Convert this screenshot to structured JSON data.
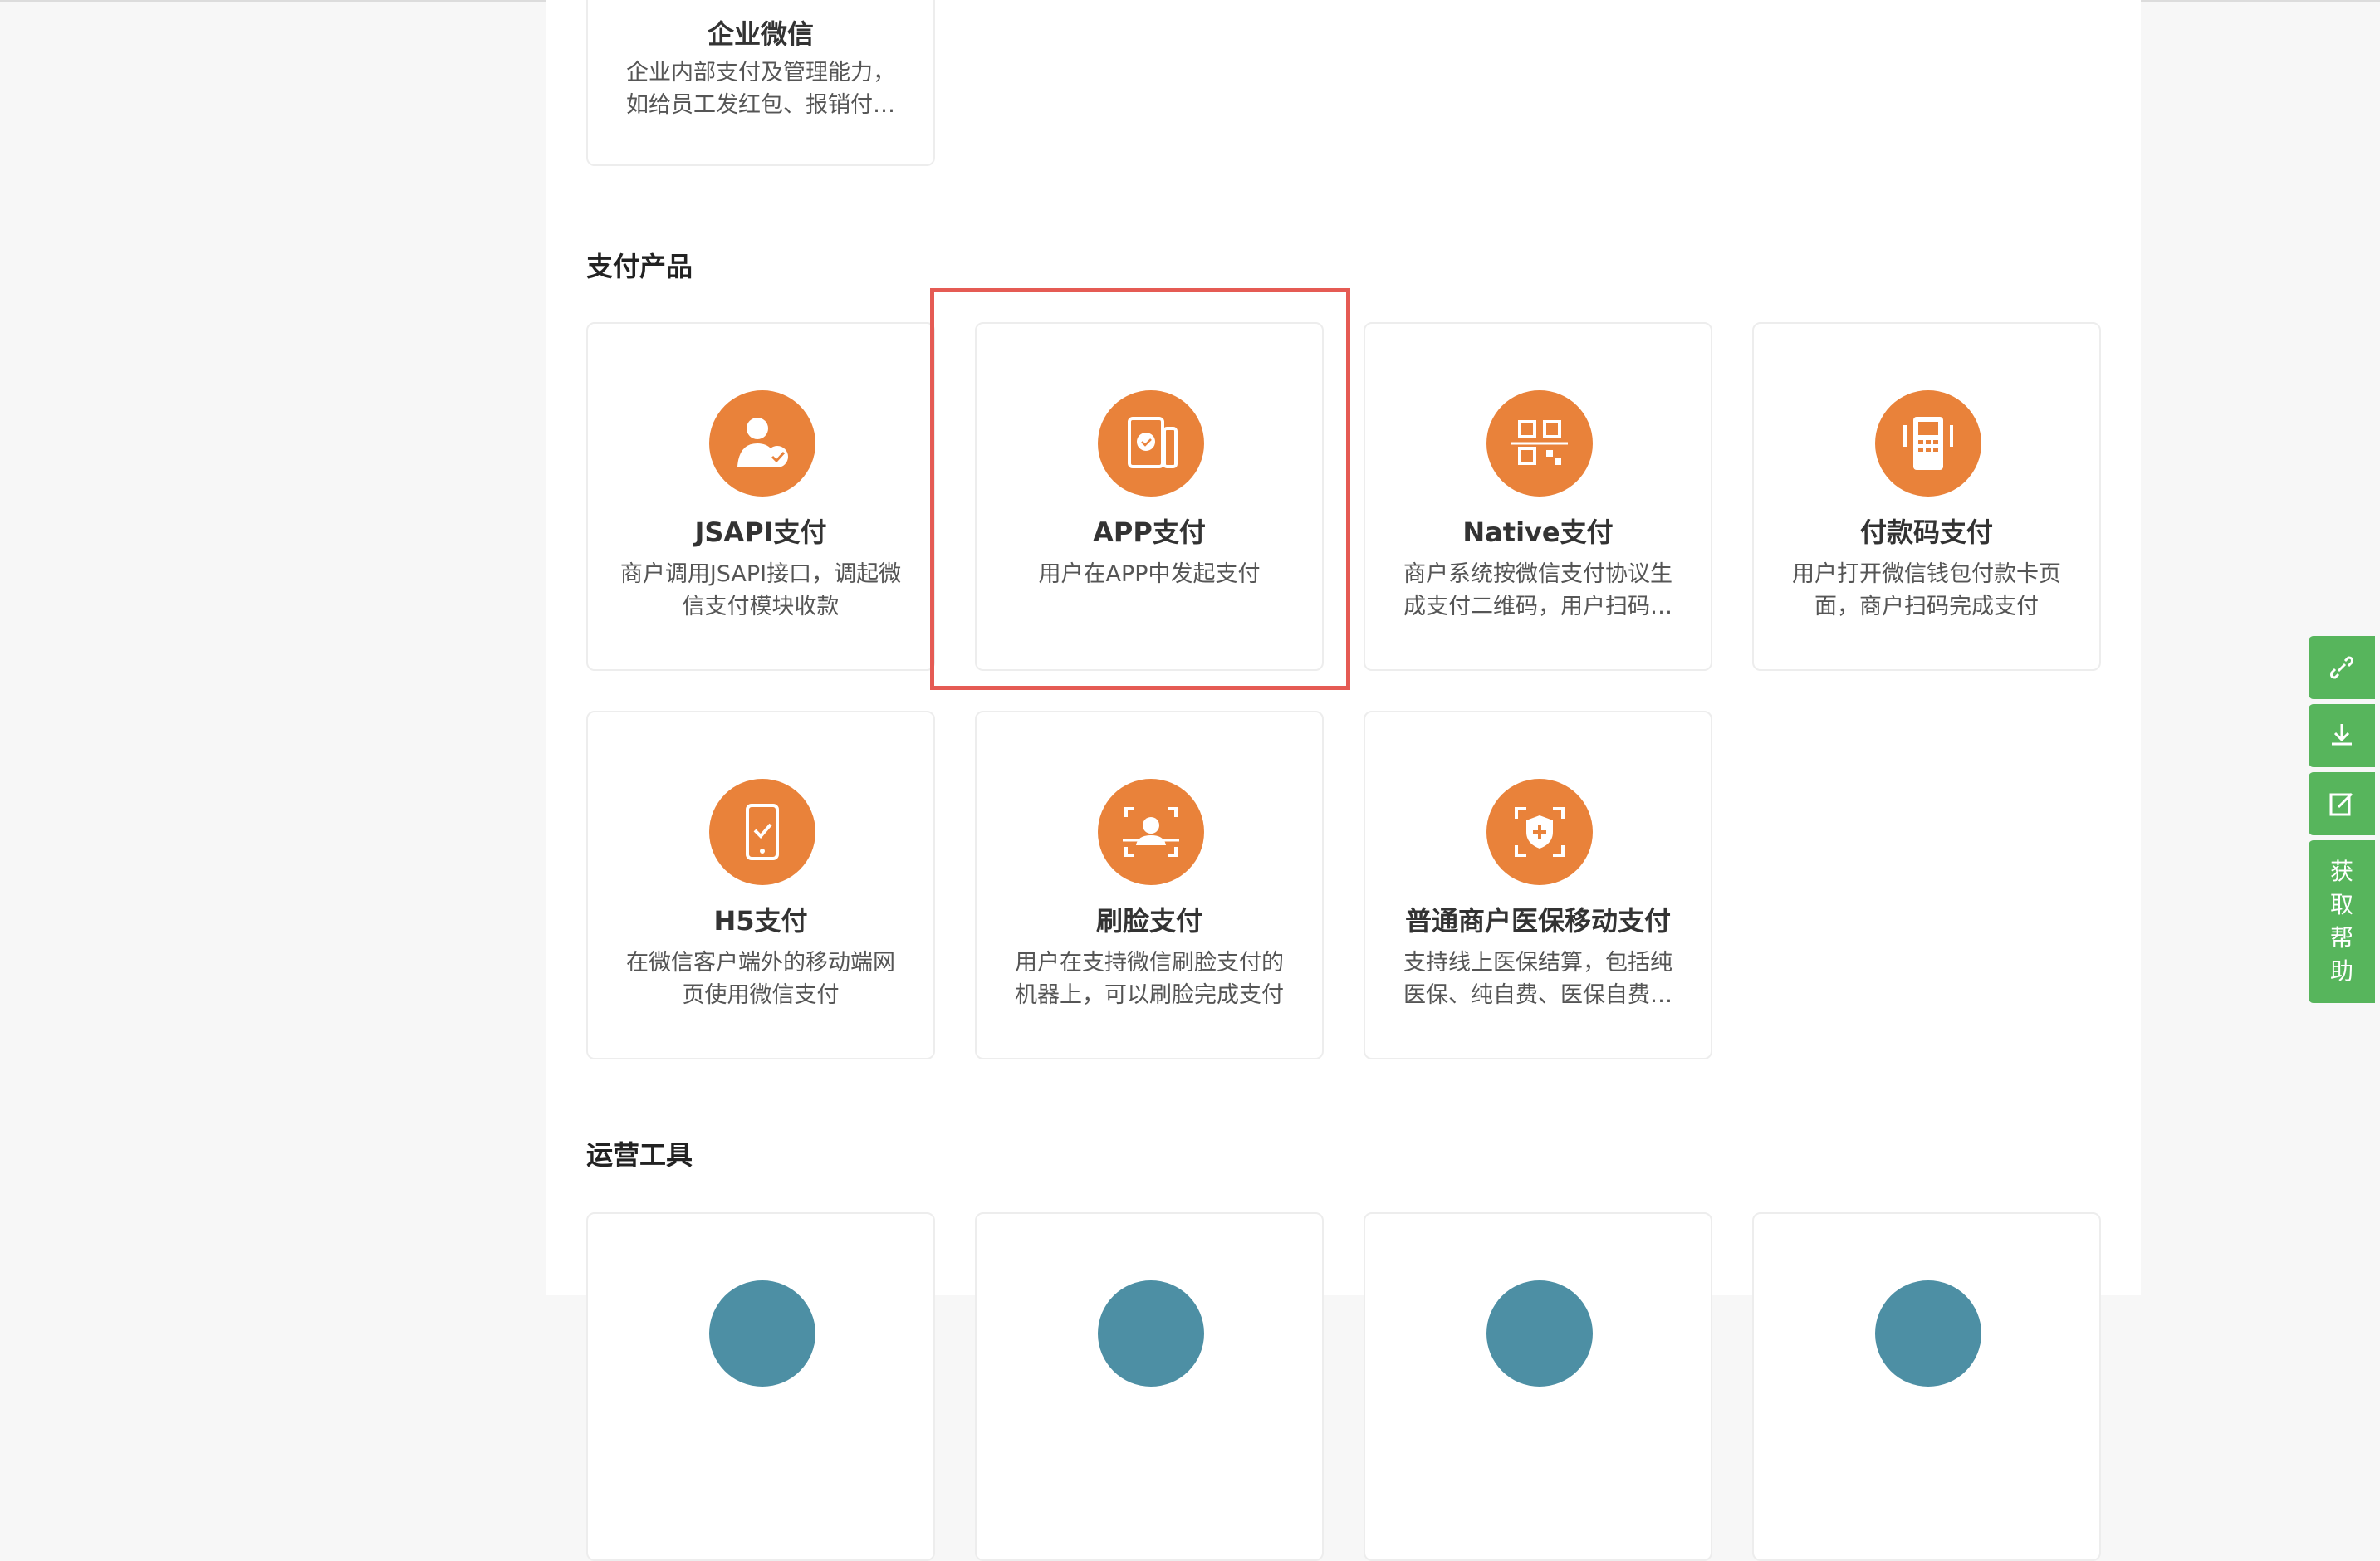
{
  "top_card": {
    "title": "企业微信",
    "desc": "企业内部支付及管理能力，如给员工发红包、报销付款等"
  },
  "sections": {
    "pay_products": "支付产品",
    "ops_tools": "运营工具"
  },
  "products": [
    {
      "title": "JSAPI支付",
      "desc": "商户调用JSAPI接口，调起微信支付模块收款",
      "icon": "user-check-icon"
    },
    {
      "title": "APP支付",
      "desc": "用户在APP中发起支付",
      "icon": "tablet-phone-icon"
    },
    {
      "title": "Native支付",
      "desc": "商户系统按微信支付协议生成支付二维码，用户扫码支付",
      "icon": "qr-scan-icon"
    },
    {
      "title": "付款码支付",
      "desc": "用户打开微信钱包付款卡页面，商户扫码完成支付",
      "icon": "pos-terminal-icon"
    },
    {
      "title": "H5支付",
      "desc": "在微信客户端外的移动端网页使用微信支付",
      "icon": "mobile-check-icon"
    },
    {
      "title": "刷脸支付",
      "desc": "用户在支持微信刷脸支付的机器上，可以刷脸完成支付",
      "icon": "face-scan-icon"
    },
    {
      "title": "普通商户医保移动支付",
      "desc": "支持线上医保结算，包括纯医保、纯自费、医保自费混合支付",
      "icon": "medical-shield-icon"
    }
  ],
  "float_bar": {
    "help_label": "获取帮助"
  },
  "colors": {
    "accent_orange": "#e9823a",
    "accent_teal": "#4d8fa4",
    "help_green": "#57b55c",
    "highlight_red": "#e55b54"
  }
}
